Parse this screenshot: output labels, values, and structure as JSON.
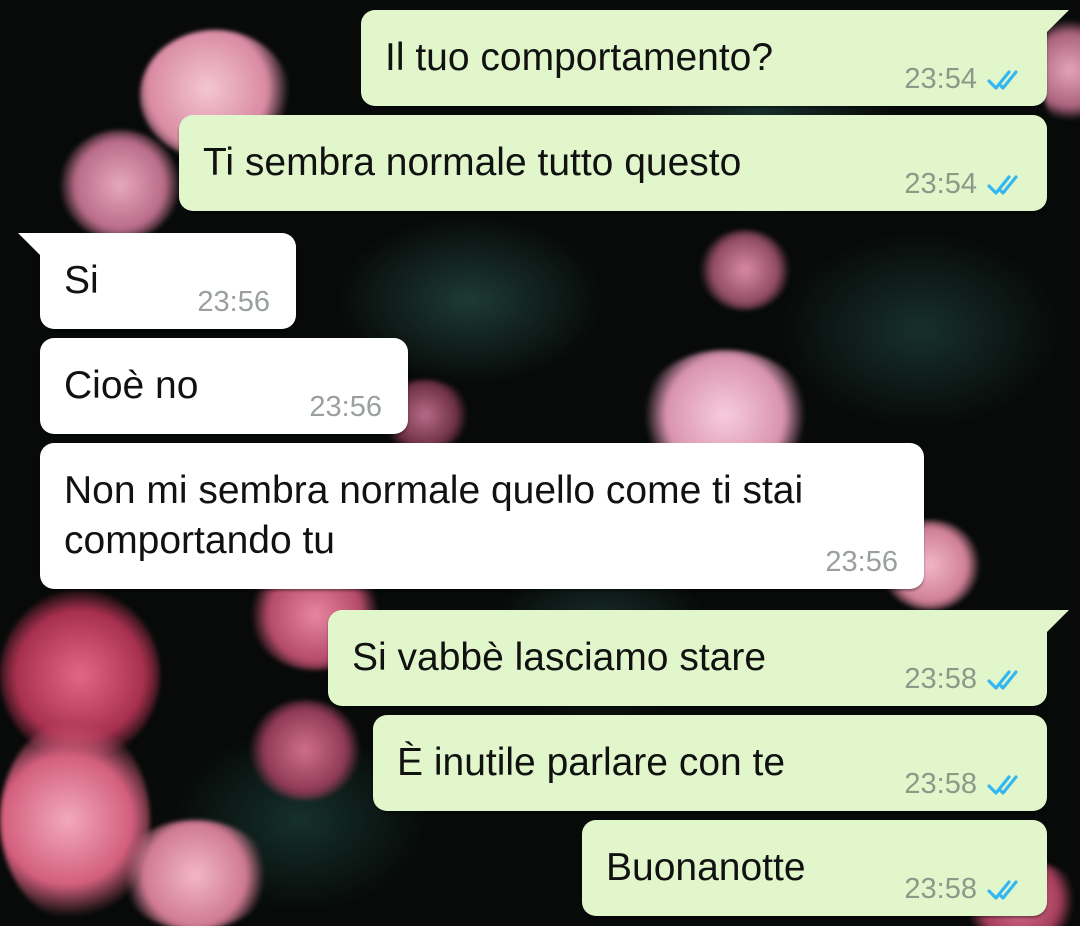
{
  "colors": {
    "outgoing_bubble": "#e1f7cb",
    "incoming_bubble": "#ffffff",
    "read_ticks": "#34b7f1",
    "timestamp": "#8b9a88"
  },
  "messages": [
    {
      "direction": "outgoing",
      "text": "Il tuo comportamento?",
      "time": "23:54",
      "status": "read-double-check-icon"
    },
    {
      "direction": "outgoing",
      "text": "Ti sembra normale tutto questo",
      "time": "23:54",
      "status": "read-double-check-icon"
    },
    {
      "direction": "incoming",
      "text": "Si",
      "time": "23:56"
    },
    {
      "direction": "incoming",
      "text": "Cioè no",
      "time": "23:56"
    },
    {
      "direction": "incoming",
      "text_line1": "Non mi sembra normale quello come ti stai",
      "text_line2": "comportando tu",
      "time": "23:56"
    },
    {
      "direction": "outgoing",
      "text": "Si vabbè lasciamo stare",
      "time": "23:58",
      "status": "read-double-check-icon"
    },
    {
      "direction": "outgoing",
      "text": "È inutile parlare con te",
      "time": "23:58",
      "status": "read-double-check-icon"
    },
    {
      "direction": "outgoing",
      "text": "Buonanotte",
      "time": "23:58",
      "status": "read-double-check-icon"
    }
  ]
}
